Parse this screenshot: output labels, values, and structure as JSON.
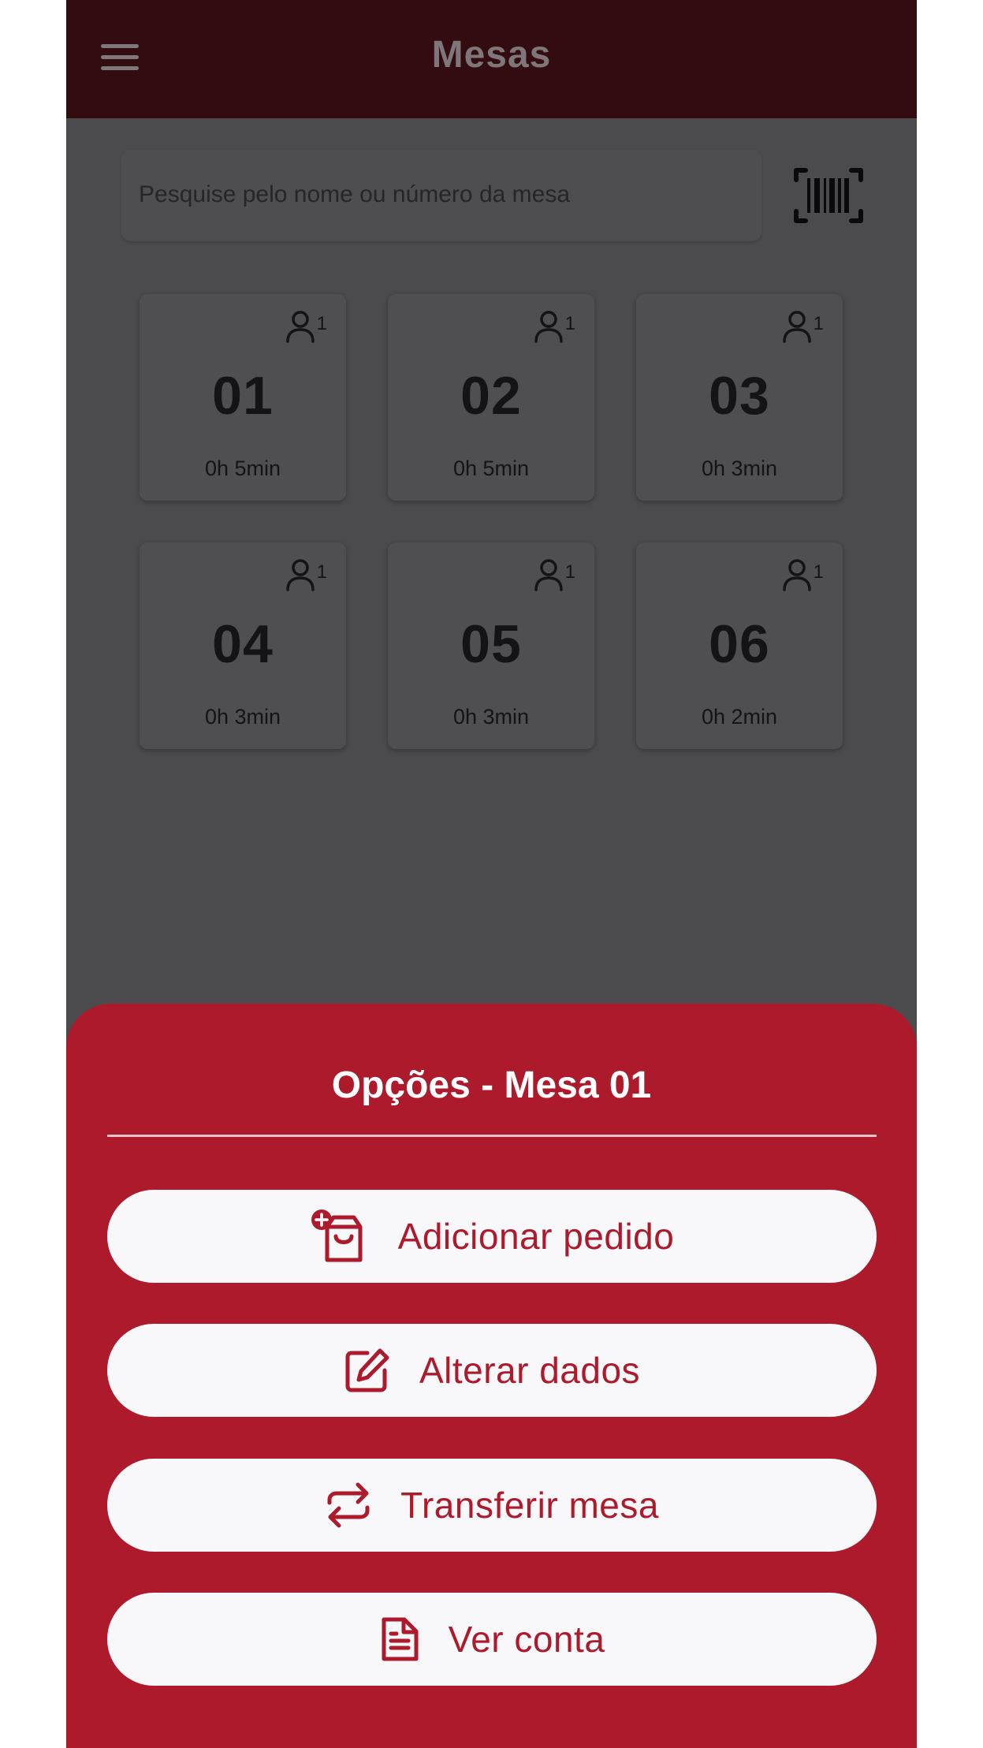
{
  "header": {
    "title": "Mesas"
  },
  "search": {
    "placeholder": "Pesquise pelo nome ou número da mesa"
  },
  "tables": [
    {
      "number": "01",
      "guests": "1",
      "time": "0h 5min"
    },
    {
      "number": "02",
      "guests": "1",
      "time": "0h 5min"
    },
    {
      "number": "03",
      "guests": "1",
      "time": "0h 3min"
    },
    {
      "number": "04",
      "guests": "1",
      "time": "0h 3min"
    },
    {
      "number": "05",
      "guests": "1",
      "time": "0h 3min"
    },
    {
      "number": "06",
      "guests": "1",
      "time": "0h 2min"
    }
  ],
  "sheet": {
    "title": "Opções - Mesa 01",
    "options": [
      {
        "label": "Adicionar pedido",
        "icon": "shopping-bag-plus-icon"
      },
      {
        "label": "Alterar dados",
        "icon": "edit-icon"
      },
      {
        "label": "Transferir mesa",
        "icon": "transfer-icon"
      },
      {
        "label": "Ver conta",
        "icon": "document-icon"
      }
    ]
  },
  "colors": {
    "brand": "#ad1a2c",
    "header_overlay": "#330c11",
    "overlay_background": "#4b4a4d",
    "button_background": "#f8f7fa"
  }
}
